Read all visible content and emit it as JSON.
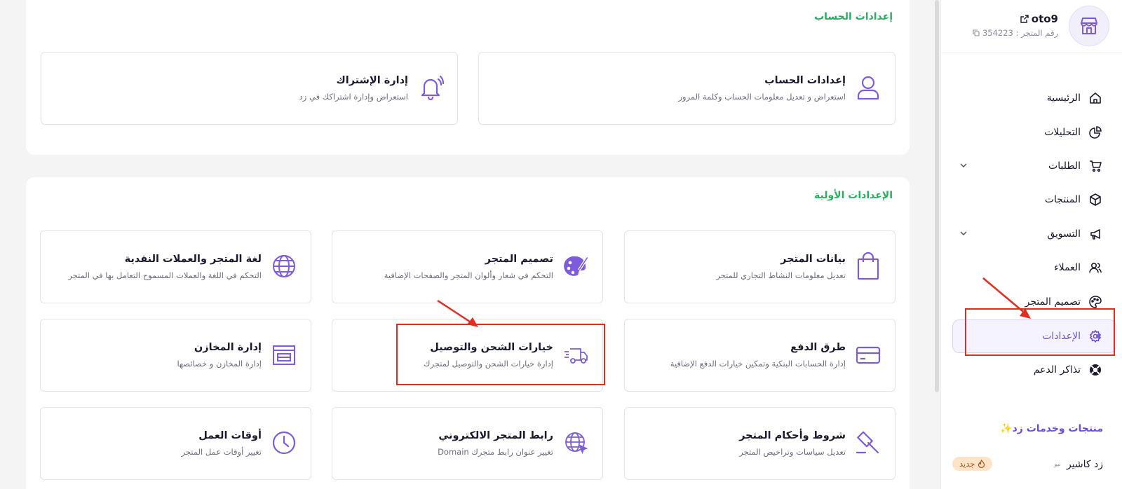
{
  "sidebar": {
    "store_name": "oto9",
    "store_number": "رقم المتجر : 354223",
    "items": [
      {
        "label": "الرئيسية",
        "icon": "home-icon"
      },
      {
        "label": "التحليلات",
        "icon": "pie-chart-icon"
      },
      {
        "label": "الطلبات",
        "icon": "cart-icon",
        "expandable": true
      },
      {
        "label": "المنتجات",
        "icon": "box-icon"
      },
      {
        "label": "التسويق",
        "icon": "megaphone-icon",
        "expandable": true
      },
      {
        "label": "العملاء",
        "icon": "users-icon"
      },
      {
        "label": "تصميم المتجر",
        "icon": "palette-icon"
      },
      {
        "label": "الإعدادات",
        "icon": "gear-icon",
        "active": true
      },
      {
        "label": "تذاكر الدعم",
        "icon": "lifebuoy-icon"
      }
    ],
    "promo_title": "منتجات وخدمات زد✨",
    "cashier_label": "زد كاشير",
    "cashier_tag": "نيو",
    "new_badge": "جديد"
  },
  "account_section": {
    "title": "إعدادات الحساب",
    "cards": [
      {
        "title": "إعدادات الحساب",
        "desc": "استعراض و تعديل معلومات الحساب وكلمة المرور",
        "icon": "user-icon"
      },
      {
        "title": "إدارة الإشتراك",
        "desc": "استعراض وإدارة اشتراكك في زد",
        "icon": "bell-icon"
      }
    ]
  },
  "initial_section": {
    "title": "الإعدادات الأولية",
    "cards": [
      {
        "title": "بيانات المتجر",
        "desc": "تعديل معلومات النشاط التجاري للمتجر",
        "icon": "shopping-bag-icon"
      },
      {
        "title": "تصميم المتجر",
        "desc": "التحكم في شعار وألوان المتجر والصفحات الإضافية",
        "icon": "palette-icon"
      },
      {
        "title": "لغة المتجر والعملات النقدية",
        "desc": "التحكم في اللغة والعملات المسموح التعامل بها في المتجر",
        "icon": "globe-icon"
      },
      {
        "title": "طرق الدفع",
        "desc": "إدارة الحسابات البنكية وتمكين خيارات الدفع الإضافية",
        "icon": "credit-card-icon"
      },
      {
        "title": "خيارات الشحن والتوصيل",
        "desc": "إدارة خيارات الشحن والتوصيل لمتجرك",
        "icon": "truck-icon"
      },
      {
        "title": "إدارة المخازن",
        "desc": "إدارة المخازن و خصائصها",
        "icon": "warehouse-icon"
      },
      {
        "title": "شروط وأحكام المتجر",
        "desc": "تعديل سياسات وتراخيص المتجر",
        "icon": "gavel-icon"
      },
      {
        "title": "رابط المتجر الالكتروني",
        "desc": "تغيير عنوان رابط متجرك Domain",
        "icon": "web-globe-icon"
      },
      {
        "title": "أوقات العمل",
        "desc": "تغيير أوقات عمل المتجر",
        "icon": "clock-icon"
      }
    ]
  },
  "colors": {
    "accent": "#7c5cdb",
    "section_title": "#27ae60",
    "annotation": "#e02d22"
  }
}
